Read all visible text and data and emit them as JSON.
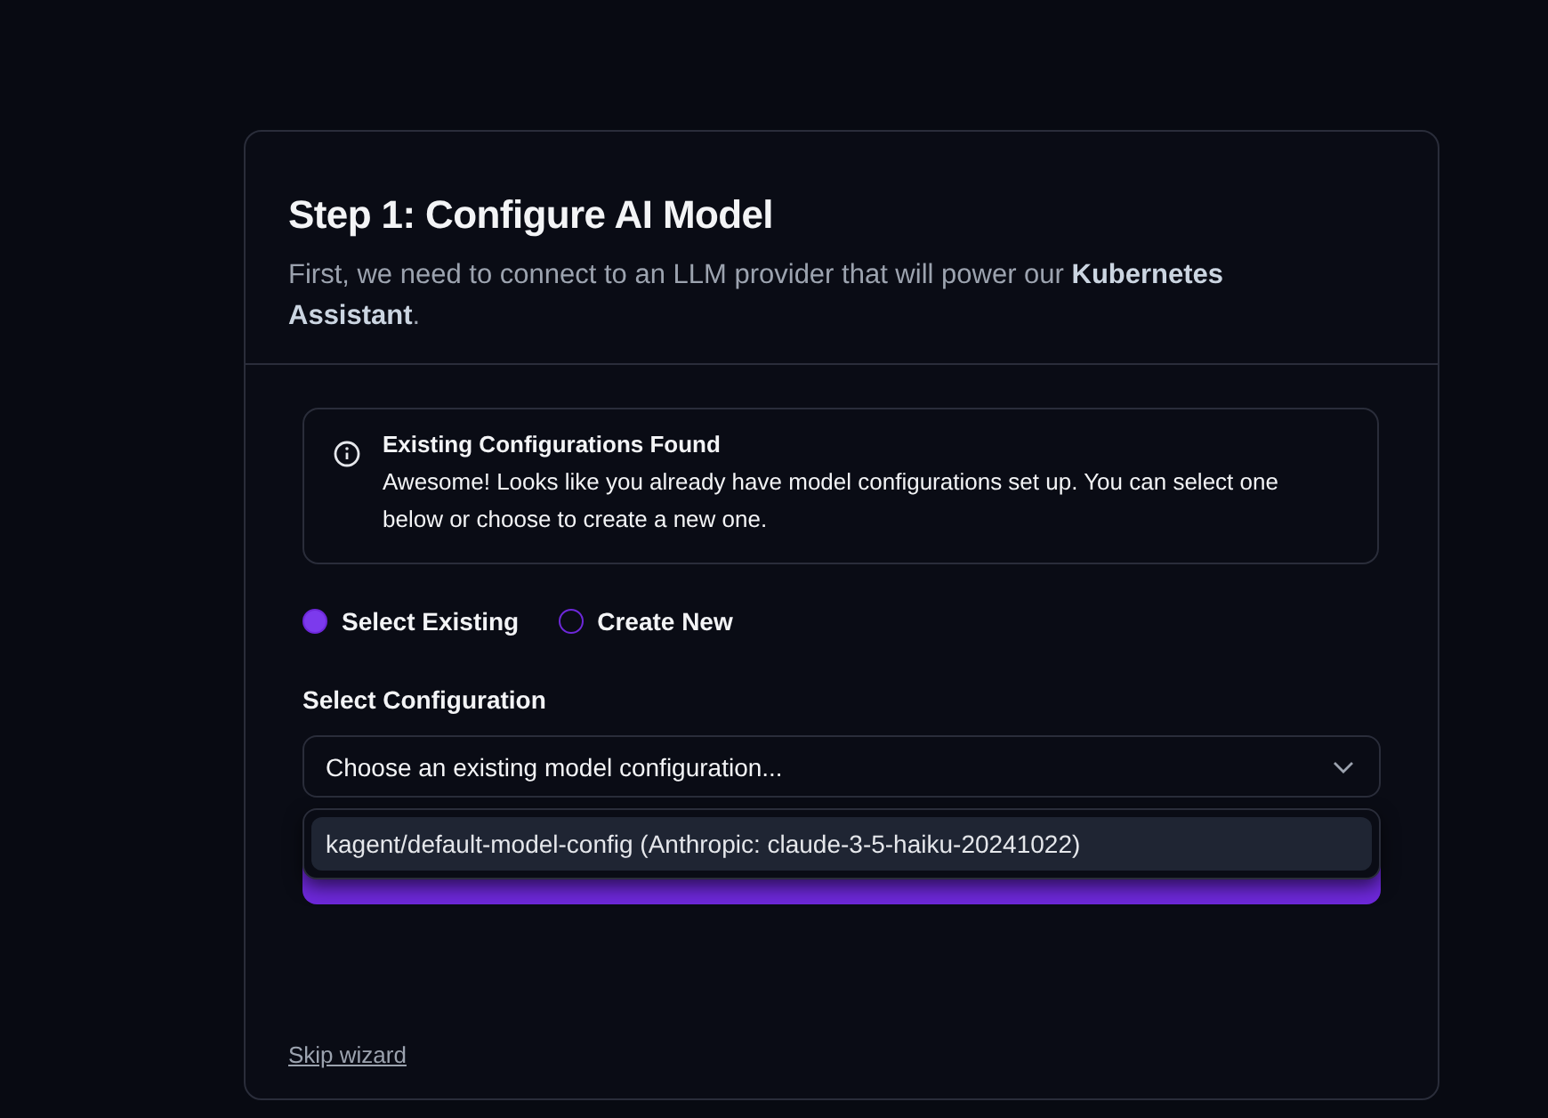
{
  "title": "Step 1: Configure AI Model",
  "subtitle": "First, we need to connect to an LLM provider that will power our **Kubernetes Assistant**.",
  "notice": {
    "title": "Existing Configurations Found",
    "text": "Awesome! Looks like you already have model configurations set up. You can select one below or choose to create a new one."
  },
  "modes": [
    {
      "label": "Select Existing",
      "selected": true
    },
    {
      "label": "Create New",
      "selected": false
    }
  ],
  "select": {
    "label": "Select Configuration",
    "placeholder": "Choose an existing model configuration...",
    "expanded": true,
    "options": [
      {
        "label": "kagent/default-model-config (Anthropic: claude-3-5-haiku-20241022)",
        "highlighted": true
      }
    ]
  },
  "skip_link": "Skip wizard"
}
